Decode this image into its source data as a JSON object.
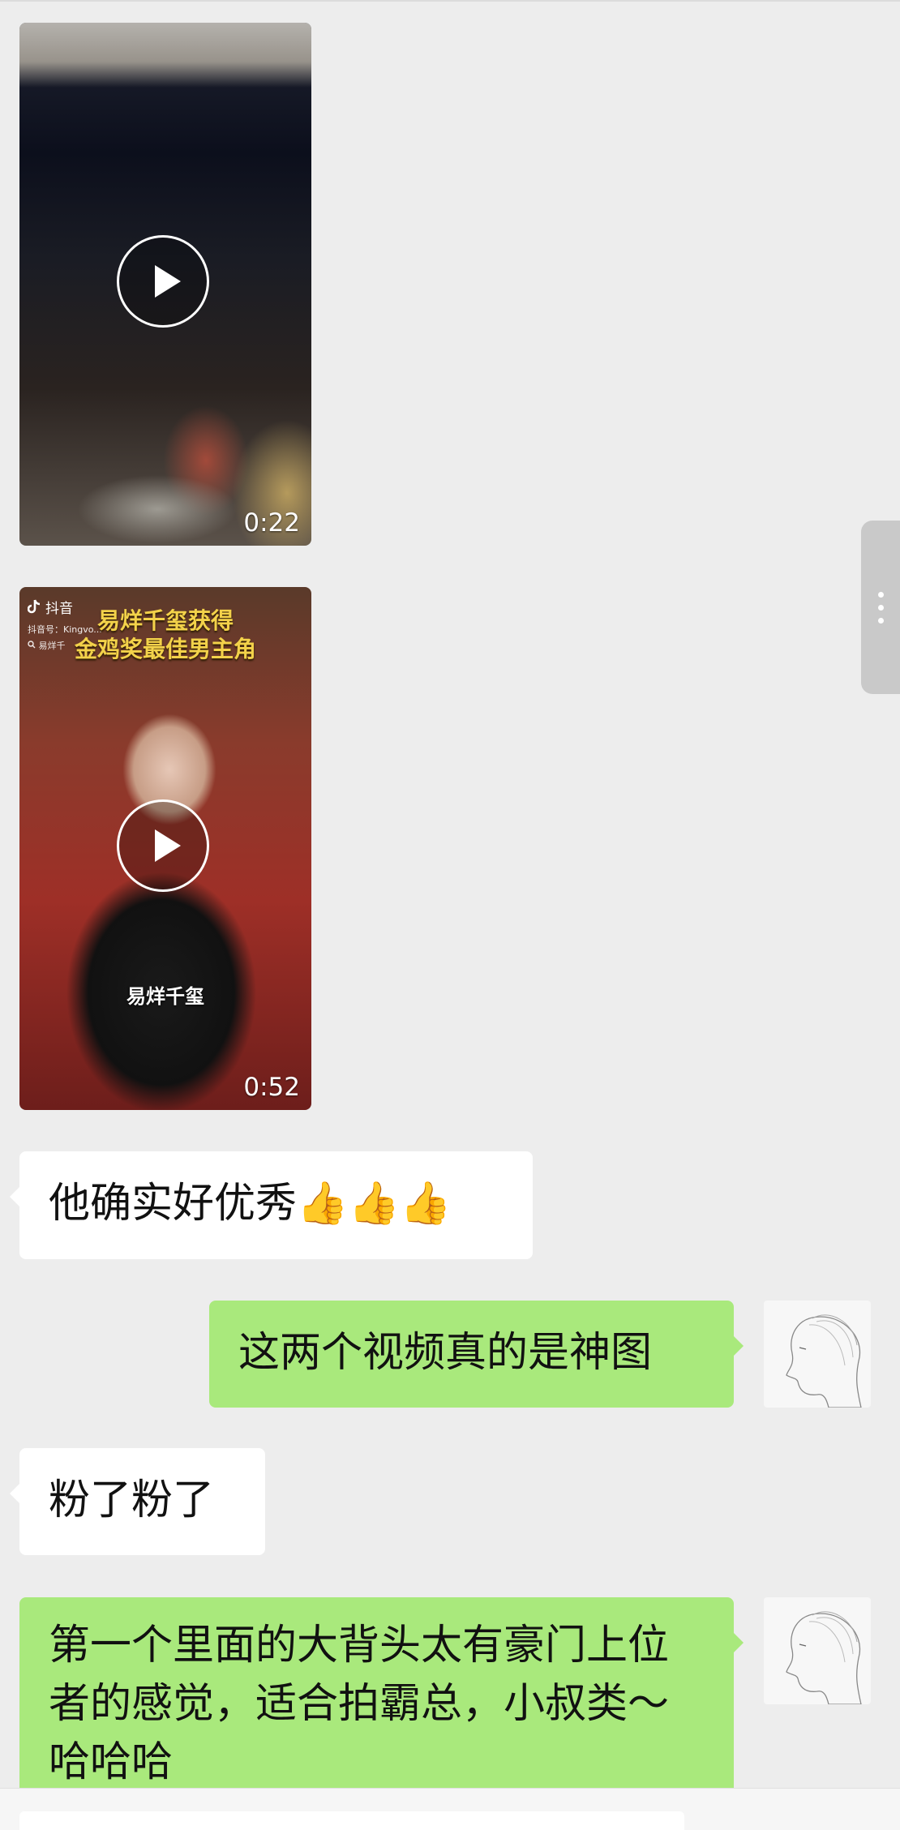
{
  "messages": {
    "video1": {
      "duration": "0:22"
    },
    "video2": {
      "duration": "0:52",
      "app_name": "抖音",
      "account_id": "抖音号：Kingvo...",
      "search_text": "易烊千",
      "caption_line1": "易烊千玺获得",
      "caption_line2": "金鸡奖最佳男主角",
      "name_overlay": "易烊千玺"
    },
    "m1": "他确实好优秀👍👍👍",
    "m2": "这两个视频真的是神图",
    "m3": "粉了粉了",
    "m4": "第一个里面的大背头太有豪门上位者的感觉，适合拍霸总，小叔类～哈哈哈"
  },
  "colors": {
    "chat_bg": "#ededed",
    "incoming_bubble": "#ffffff",
    "outgoing_bubble": "#a9e97c"
  },
  "icons": [
    "play-icon",
    "douyin-logo-icon",
    "search-icon",
    "more-dots-icon",
    "user-avatar"
  ]
}
